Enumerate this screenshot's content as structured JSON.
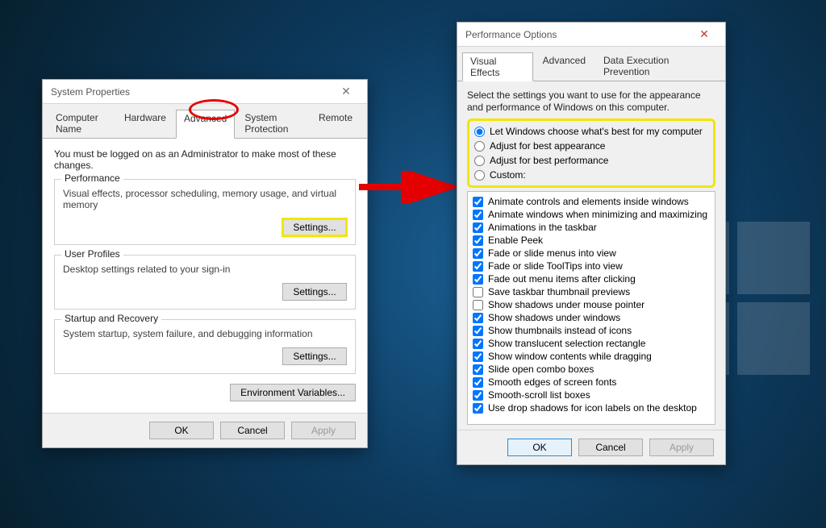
{
  "sysprops": {
    "title": "System Properties",
    "tabs": {
      "computer_name": "Computer Name",
      "hardware": "Hardware",
      "advanced": "Advanced",
      "system_protection": "System Protection",
      "remote": "Remote"
    },
    "active_tab": "advanced",
    "admin_note": "You must be logged on as an Administrator to make most of these changes.",
    "groups": {
      "performance": {
        "legend": "Performance",
        "desc": "Visual effects, processor scheduling, memory usage, and virtual memory",
        "btn": "Settings..."
      },
      "user_profiles": {
        "legend": "User Profiles",
        "desc": "Desktop settings related to your sign-in",
        "btn": "Settings..."
      },
      "startup": {
        "legend": "Startup and Recovery",
        "desc": "System startup, system failure, and debugging information",
        "btn": "Settings..."
      }
    },
    "envvars_btn": "Environment Variables...",
    "buttons": {
      "ok": "OK",
      "cancel": "Cancel",
      "apply": "Apply"
    }
  },
  "perfopts": {
    "title": "Performance Options",
    "tabs": {
      "visual_effects": "Visual Effects",
      "advanced": "Advanced",
      "dep": "Data Execution Prevention"
    },
    "active_tab": "visual_effects",
    "intro": "Select the settings you want to use for the appearance and performance of Windows on this computer.",
    "radios": {
      "auto": "Let Windows choose what's best for my computer",
      "appearance": "Adjust for best appearance",
      "performance": "Adjust for best performance",
      "custom": "Custom:"
    },
    "selected_radio": "auto",
    "checks": [
      {
        "label": "Animate controls and elements inside windows",
        "checked": true
      },
      {
        "label": "Animate windows when minimizing and maximizing",
        "checked": true
      },
      {
        "label": "Animations in the taskbar",
        "checked": true
      },
      {
        "label": "Enable Peek",
        "checked": true
      },
      {
        "label": "Fade or slide menus into view",
        "checked": true
      },
      {
        "label": "Fade or slide ToolTips into view",
        "checked": true
      },
      {
        "label": "Fade out menu items after clicking",
        "checked": true
      },
      {
        "label": "Save taskbar thumbnail previews",
        "checked": false
      },
      {
        "label": "Show shadows under mouse pointer",
        "checked": false
      },
      {
        "label": "Show shadows under windows",
        "checked": true
      },
      {
        "label": "Show thumbnails instead of icons",
        "checked": true
      },
      {
        "label": "Show translucent selection rectangle",
        "checked": true
      },
      {
        "label": "Show window contents while dragging",
        "checked": true
      },
      {
        "label": "Slide open combo boxes",
        "checked": true
      },
      {
        "label": "Smooth edges of screen fonts",
        "checked": true
      },
      {
        "label": "Smooth-scroll list boxes",
        "checked": true
      },
      {
        "label": "Use drop shadows for icon labels on the desktop",
        "checked": true
      }
    ],
    "buttons": {
      "ok": "OK",
      "cancel": "Cancel",
      "apply": "Apply"
    }
  }
}
